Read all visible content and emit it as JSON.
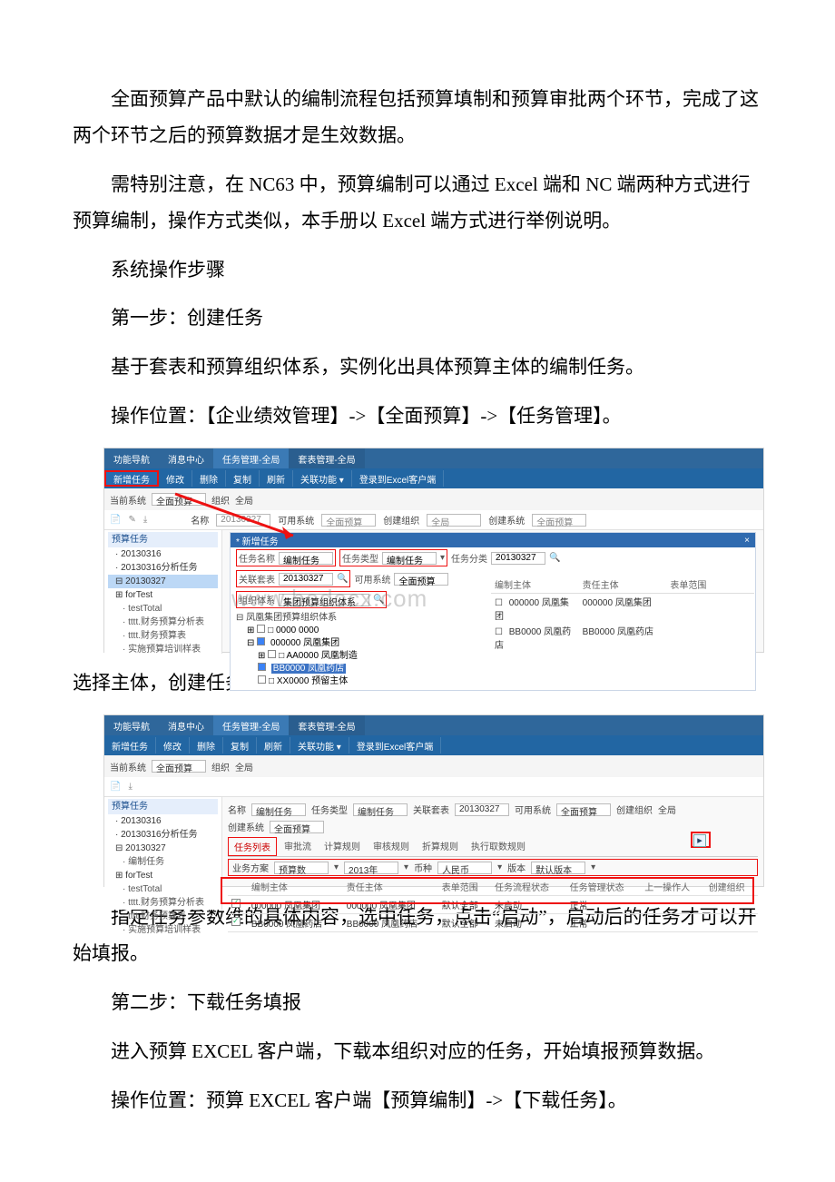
{
  "paragraphs": {
    "p1": "全面预算产品中默认的编制流程包括预算填制和预算审批两个环节，完成了这两个环节之后的预算数据才是生效数据。",
    "p2": "需特别注意，在 NC63 中，预算编制可以通过 Excel 端和 NC 端两种方式进行预算编制，操作方式类似，本手册以 Excel 端方式进行举例说明。",
    "p3": "系统操作步骤",
    "p4": "第一步：创建任务",
    "p5": "基于套表和预算组织体系，实例化出具体预算主体的编制任务。",
    "p6": "操作位置：【企业绩效管理】->【全面预算】->【任务管理】。",
    "p7": "选择主体，创建任务后：",
    "p8": "指定任务参数维的具体内容，选中任务，点击“启动”，启动后的任务才可以开始填报。",
    "p9": "第二步：下载任务填报",
    "p10": "进入预算 EXCEL 客户端，下载本组织对应的任务，开始填报预算数据。",
    "p11": "操作位置：预算 EXCEL 客户端【预算编制】->【下载任务】。"
  },
  "ss1": {
    "tabs": {
      "t1": "功能导航",
      "t2": "消息中心",
      "t3": "任务管理-全局",
      "t4": "套表管理-全局"
    },
    "toolbar": {
      "b1": "新增任务",
      "b2": "修改",
      "b3": "删除",
      "b4": "复制",
      "b5": "刷新",
      "b6": "关联功能 ▾",
      "b7": "登录到Excel客户端"
    },
    "filter": {
      "cur_sys_lbl": "当前系统",
      "cur_sys_val": "全面预算",
      "org_lbl": "组织",
      "org_val": "全局",
      "name_lbl": "名称",
      "name_val": "20130327",
      "use_sys_lbl": "可用系统",
      "use_sys_val": "全面预算",
      "create_org_lbl": "创建组织",
      "create_org_val": "全局",
      "create_sys_lbl": "创建系统",
      "create_sys_val": "全面预算"
    },
    "tree": {
      "hdr": "预算任务",
      "n1": "20130316",
      "n2": "20130316分析任务",
      "n3": "20130327",
      "n4": "forTest",
      "n5": "testTotal",
      "n6": "tttt.财务预算分析表",
      "n7": "tttt.财务预算表",
      "n8": "实施预算培训样表"
    },
    "dialog": {
      "title": "新增任务",
      "task_name_lbl": "任务名称",
      "task_name_val": "编制任务",
      "task_type_lbl": "任务类型",
      "task_type_val": "编制任务",
      "task_cat_lbl": "任务分类",
      "task_cat_val": "20130327",
      "rel_sheet_lbl": "关联套表",
      "rel_sheet_val": "20130327",
      "use_sys_lbl": "可用系统",
      "use_sys_val": "全面预算",
      "org_sys_lbl": "组织体系",
      "org_sys_val": "集团预算组织体系",
      "tree_root": "凤凰集团预算组织体系",
      "tnode0": "0000 0000",
      "tnode1": "000000 凤凰集团",
      "tnode2": "AA0000 凤凰制造",
      "tnode3": "BB0000 凤凰药店",
      "tnode4": "XX0000 预留主体"
    },
    "rtable": {
      "h1": "编制主体",
      "h2": "责任主体",
      "h3": "表单范围",
      "r1a": "000000 凤凰集团",
      "r1b": "000000 凤凰集团",
      "r2a": "BB0000 凤凰药店",
      "r2b": "BB0000 凤凰药店"
    },
    "watermark": "www.bodocx.com",
    "close": "×"
  },
  "ss2": {
    "tabs": {
      "t1": "功能导航",
      "t2": "消息中心",
      "t3": "任务管理-全局",
      "t4": "套表管理-全局"
    },
    "toolbar": {
      "b1": "新增任务",
      "b2": "修改",
      "b3": "删除",
      "b4": "复制",
      "b5": "刷新",
      "b6": "关联功能 ▾",
      "b7": "登录到Excel客户端"
    },
    "filter": {
      "cur_sys_lbl": "当前系统",
      "cur_sys_val": "全面预算",
      "org_lbl": "组织",
      "org_val": "全局"
    },
    "tree": {
      "hdr": "预算任务",
      "n1": "20130316",
      "n2": "20130316分析任务",
      "n3": "20130327",
      "n3a": "编制任务",
      "n4": "forTest",
      "n5": "testTotal",
      "n6": "tttt.财务预算分析表",
      "n7": "tttt.财务预算表",
      "n8": "实施预算培训样表"
    },
    "detail": {
      "name_lbl": "名称",
      "name_val": "编制任务",
      "type_lbl": "任务类型",
      "type_val": "编制任务",
      "rel_lbl": "关联套表",
      "rel_val": "20130327",
      "use_lbl": "可用系统",
      "use_val": "全面预算",
      "csys_lbl": "创建系统",
      "csys_val": "全面预算",
      "corg_lbl": "创建组织",
      "corg_val": "全局"
    },
    "subtabs": {
      "t1": "任务列表",
      "t2": "审批流",
      "t3": "计算规则",
      "t4": "审核规则",
      "t5": "折算规则",
      "t6": "执行取数规则"
    },
    "plan": {
      "biz_lbl": "业务方案",
      "biz_val": "预算数",
      "year_val": "2013年",
      "curr_lbl": "币种",
      "curr_val": "人民币",
      "ver_lbl": "版本",
      "ver_val": "默认版本"
    },
    "table": {
      "h1": "编制主体",
      "h2": "责任主体",
      "h3": "表单范围",
      "h4": "任务流程状态",
      "h5": "任务管理状态",
      "h6": "上一操作人",
      "h7": "创建组织",
      "r1": {
        "c1": "000000 凤凰集团",
        "c2": "000000 凤凰集团",
        "c3": "默认全部",
        "c4": "未启动",
        "c5": "正常"
      },
      "r2": {
        "c1": "BB0000 凤凰药店",
        "c2": "BB0000 凤凰药店",
        "c3": "默认全部",
        "c4": "未启动",
        "c5": "正常"
      }
    },
    "play_btn": "▸"
  }
}
